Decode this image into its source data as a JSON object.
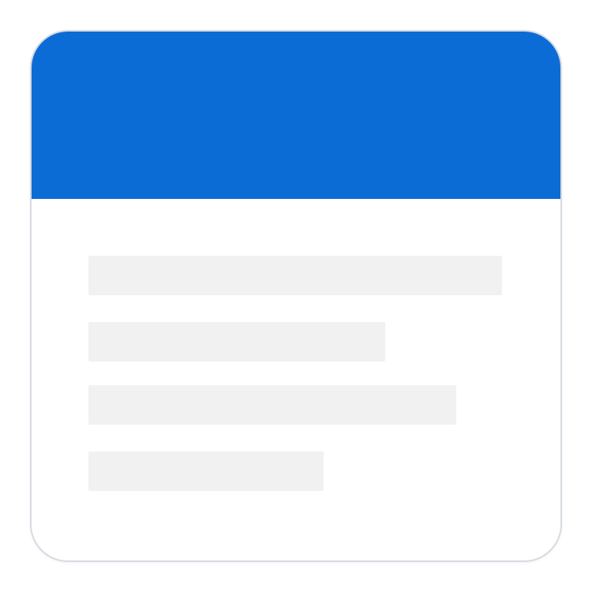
{
  "icon": {
    "name": "notes-document-icon",
    "header_color": "#0b6cd6",
    "body_color": "#ffffff",
    "line_color": "#f1f1f1",
    "text_lines": [
      {
        "id": "line-1"
      },
      {
        "id": "line-2"
      },
      {
        "id": "line-3"
      },
      {
        "id": "line-4"
      }
    ]
  }
}
